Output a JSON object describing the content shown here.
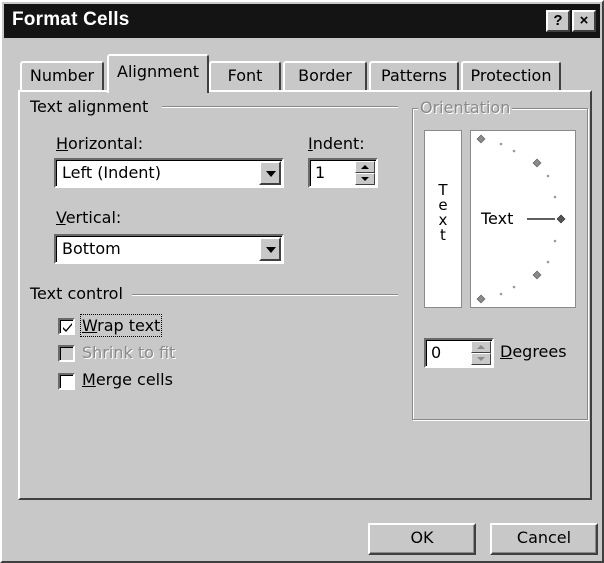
{
  "window": {
    "title": "Format Cells",
    "help_glyph": "?",
    "close_glyph": "×"
  },
  "tabs": [
    {
      "label": "Number"
    },
    {
      "label": "Alignment"
    },
    {
      "label": "Font"
    },
    {
      "label": "Border"
    },
    {
      "label": "Patterns"
    },
    {
      "label": "Protection"
    }
  ],
  "active_tab": "Alignment",
  "text_alignment": {
    "section_label": "Text alignment",
    "horizontal": {
      "label": "Horizontal:",
      "value": "Left (Indent)"
    },
    "indent": {
      "label": "Indent:",
      "value": "1"
    },
    "vertical": {
      "label": "Vertical:",
      "value": "Bottom"
    }
  },
  "text_control": {
    "section_label": "Text control",
    "wrap_text": {
      "label": "Wrap text",
      "checked": true,
      "enabled": true
    },
    "shrink_to_fit": {
      "label": "Shrink to fit",
      "checked": false,
      "enabled": false
    },
    "merge_cells": {
      "label": "Merge cells",
      "checked": false,
      "enabled": true
    }
  },
  "orientation": {
    "group_label": "Orientation",
    "vertical_text": [
      "T",
      "e",
      "x",
      "t"
    ],
    "dial_text": "Text",
    "degrees_value": "0",
    "degrees_label": "Degrees"
  },
  "buttons": {
    "ok": "OK",
    "cancel": "Cancel"
  }
}
